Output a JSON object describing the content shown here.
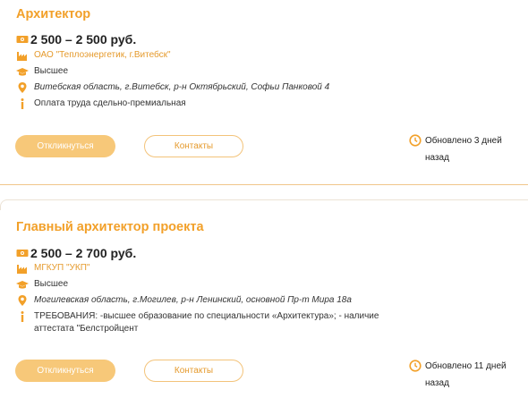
{
  "vacancies": [
    {
      "title": "Архитектор",
      "salary": "2 500 – 2 500 руб.",
      "company": "ОАО \"Теплоэнергетик, г.Витебск\"",
      "education": "Высшее",
      "address": "Витебская область, г.Витебск, р-н Октябрьский, Софьи Панковой 4",
      "info": "Оплата труда сдельно-премиальная",
      "respond_label": "Откликнуться",
      "contacts_label": "Контакты",
      "updated": "Обновлено 3 дней назад"
    },
    {
      "title": "Главный архитектор проекта",
      "salary": "2 500 – 2 700 руб.",
      "company": "МГКУП \"УКП\"",
      "education": "Высшее",
      "address": "Могилевская область, г.Могилев, р-н Ленинский, основной Пр-т Мира 18а",
      "info": "ТРЕБОВАНИЯ: -высшее образование по специальности «Архитектура»; - наличие аттестата \"Белстройцент",
      "respond_label": "Откликнуться",
      "contacts_label": "Контакты",
      "updated": "Обновлено 11 дней назад"
    }
  ],
  "icons": {
    "salary": "money-icon",
    "company": "factory-icon",
    "education": "graduation-cap-icon",
    "address": "location-pin-icon",
    "info": "info-icon",
    "updated": "clock-icon"
  },
  "colors": {
    "accent": "#f2a029",
    "button_fill": "#f7c879",
    "button_outline": "#f3c37a"
  }
}
